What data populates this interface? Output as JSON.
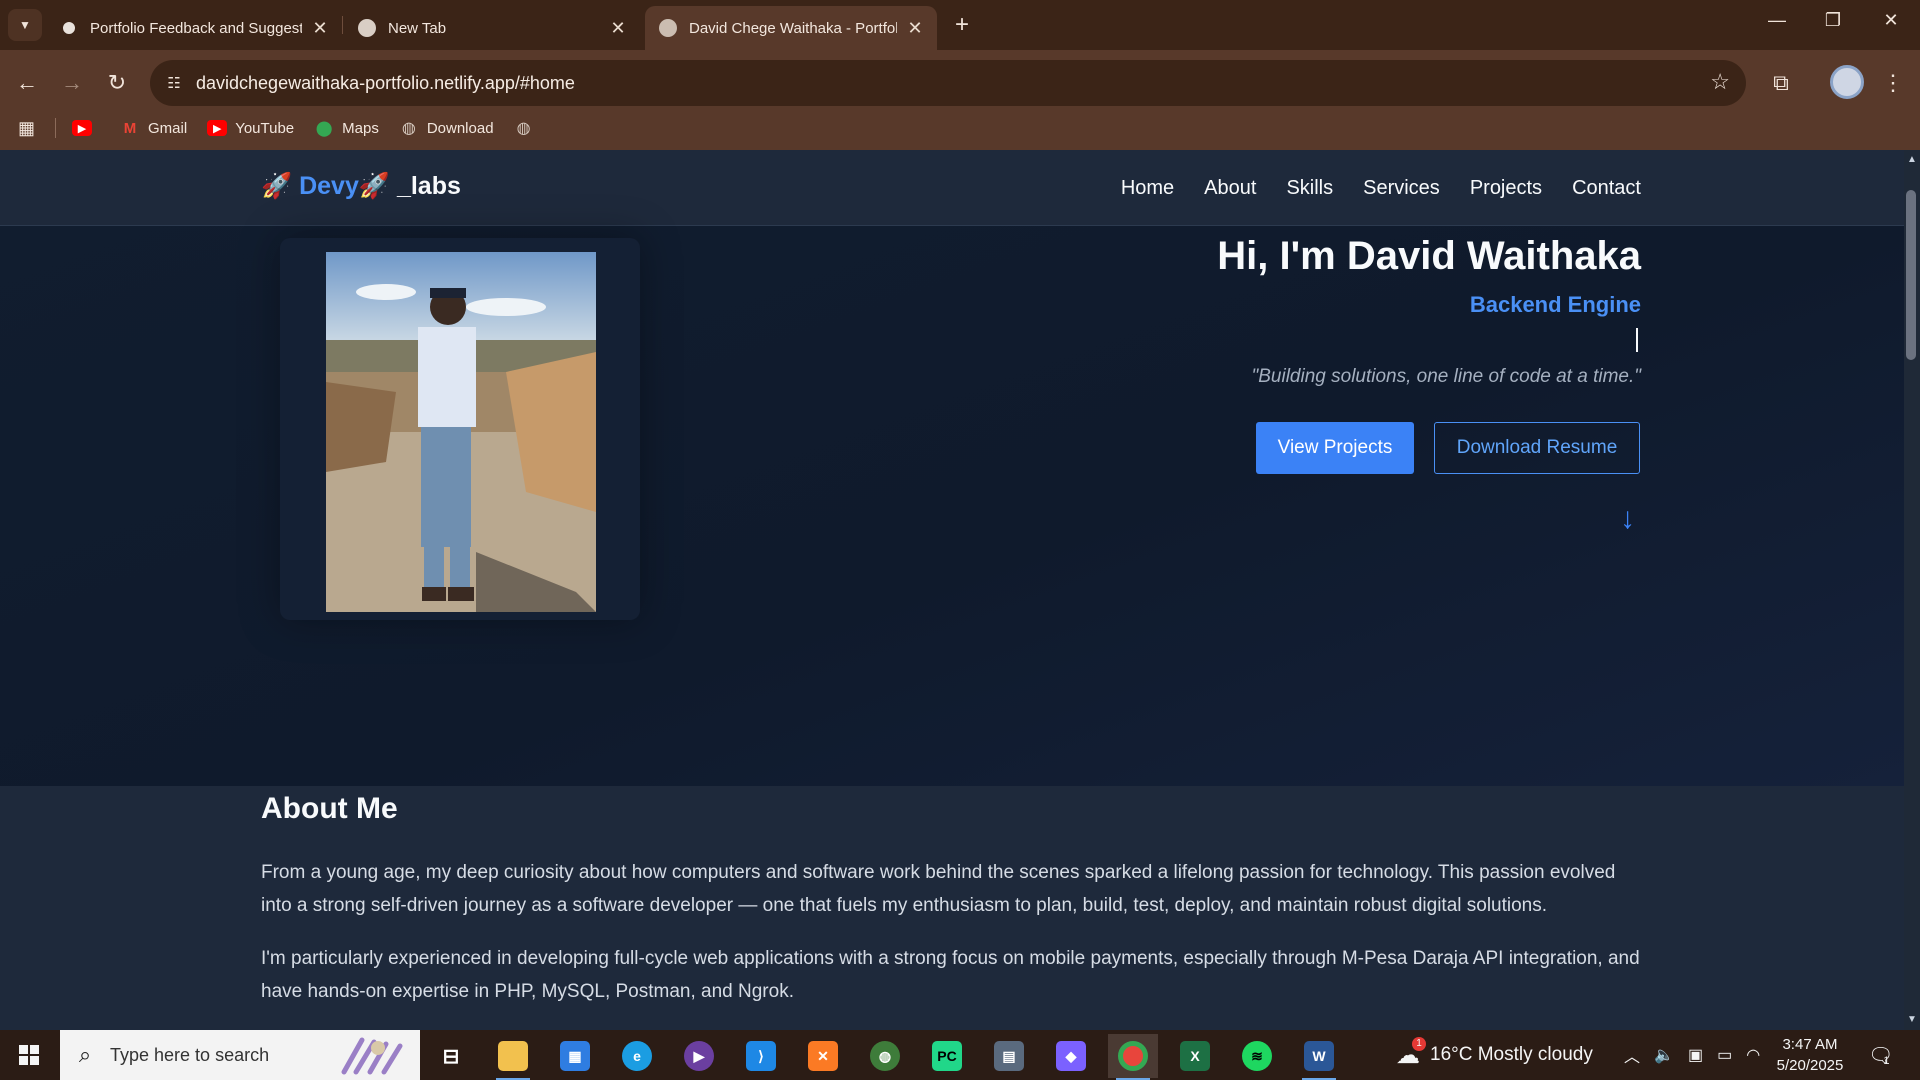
{
  "browser": {
    "tabs": [
      {
        "title": "Portfolio Feedback and Suggest",
        "active": false
      },
      {
        "title": "New Tab",
        "active": false
      },
      {
        "title": "David Chege Waithaka - Portfol",
        "active": true
      }
    ],
    "url": "davidchegewaithaka-portfolio.netlify.app/#home",
    "bookmarks": [
      {
        "label": "",
        "icon": "youtube-icon"
      },
      {
        "label": "Gmail",
        "icon": "gmail-icon"
      },
      {
        "label": "YouTube",
        "icon": "youtube-icon"
      },
      {
        "label": "Maps",
        "icon": "maps-icon"
      },
      {
        "label": "Download",
        "icon": "globe-icon"
      },
      {
        "label": "",
        "icon": "globe-icon"
      }
    ]
  },
  "site": {
    "logo_prefix": "Devy",
    "logo_suffix": "_labs",
    "logo_emoji": "🚀",
    "nav": [
      "Home",
      "About",
      "Skills",
      "Services",
      "Projects",
      "Contact"
    ],
    "hero": {
      "name": "Hi, I'm David Waithaka",
      "role": "Backend Engine",
      "tagline": "\"Building solutions, one line of code at a time.\"",
      "primary_button": "View Projects",
      "secondary_button": "Download Resume",
      "scroll_arrow": "↓"
    },
    "about": {
      "heading": "About Me",
      "paragraphs": [
        "From a young age, my deep curiosity about how computers and software work behind the scenes sparked a lifelong passion for technology. This passion evolved into a strong self-driven journey as a software developer — one that fuels my enthusiasm to plan, build, test, deploy, and maintain robust digital solutions.",
        "I'm particularly experienced in developing full-cycle web applications with a strong focus on mobile payments, especially through M-Pesa Daraja API integration, and have hands-on expertise in PHP, MySQL, Postman, and Ngrok."
      ]
    },
    "colors": {
      "accent": "#3b82f6",
      "background": "#1e293b",
      "hero": "#0f1a2c"
    }
  },
  "taskbar": {
    "search_placeholder": "Type here to search",
    "weather": "16°C  Mostly cloudy",
    "time": "3:47 AM",
    "date": "5/20/2025",
    "notification_count": "1",
    "weather_badge": "1"
  }
}
